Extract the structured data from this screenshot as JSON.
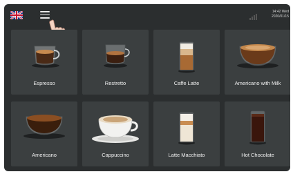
{
  "header": {
    "language_flag": "uk-flag-icon",
    "menu_icon": "hamburger-menu-icon",
    "time": "14:42 Wed",
    "date": "2020/01/15"
  },
  "drinks": [
    {
      "label": "Espresso",
      "icon": "espresso-cup-icon"
    },
    {
      "label": "Restretto",
      "icon": "ristretto-glass-icon"
    },
    {
      "label": "Caffe Latte",
      "icon": "latte-glass-icon"
    },
    {
      "label": "Americano with Milk",
      "icon": "americano-milk-cup-icon"
    },
    {
      "label": "Americano",
      "icon": "americano-cup-icon"
    },
    {
      "label": "Cappuccino",
      "icon": "cappuccino-cup-icon"
    },
    {
      "label": "Latte Macchiato",
      "icon": "latte-macchiato-glass-icon"
    },
    {
      "label": "Hot Chocolate",
      "icon": "hot-chocolate-glass-icon"
    }
  ]
}
